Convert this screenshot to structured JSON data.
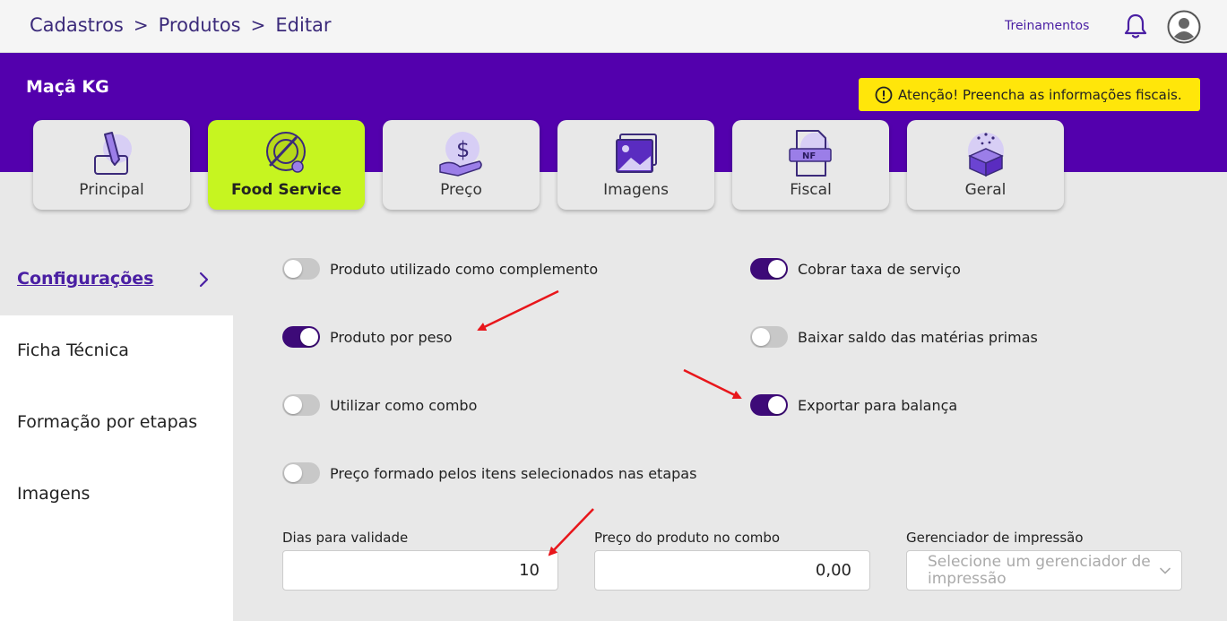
{
  "breadcrumb": {
    "items": [
      "Cadastros",
      "Produtos",
      "Editar"
    ],
    "separator": ">"
  },
  "header": {
    "training_link": "Treinamentos"
  },
  "product": {
    "name": "Maçã KG"
  },
  "alert": {
    "text": "Atenção! Preencha as informações fiscais.",
    "color": "#ffe60a"
  },
  "tabs": [
    {
      "label": "Principal",
      "icon": "edit-document-icon",
      "active": false
    },
    {
      "label": "Food Service",
      "icon": "food-plate-icon",
      "active": true
    },
    {
      "label": "Preço",
      "icon": "price-hand-icon",
      "active": false
    },
    {
      "label": "Imagens",
      "icon": "images-icon",
      "active": false
    },
    {
      "label": "Fiscal",
      "icon": "nf-document-icon",
      "active": false
    },
    {
      "label": "Geral",
      "icon": "gift-box-icon",
      "active": false
    }
  ],
  "sidebar": {
    "items": [
      {
        "label": "Configurações",
        "active": true
      },
      {
        "label": "Ficha Técnica",
        "active": false
      },
      {
        "label": "Formação por etapas",
        "active": false
      },
      {
        "label": "Imagens",
        "active": false
      }
    ]
  },
  "toggles": [
    {
      "label": "Produto utilizado como complemento",
      "on": false
    },
    {
      "label": "Cobrar taxa de serviço",
      "on": true
    },
    {
      "label": "Produto por peso",
      "on": true
    },
    {
      "label": "Baixar saldo das matérias primas",
      "on": false
    },
    {
      "label": "Utilizar como combo",
      "on": false
    },
    {
      "label": "Exportar para balança",
      "on": true
    },
    {
      "label": "Preço formado pelos itens selecionados nas etapas",
      "on": false
    }
  ],
  "fields": {
    "validity": {
      "label": "Dias para validade",
      "value": "10"
    },
    "combo_price": {
      "label": "Preço do produto no combo",
      "value": "0,00"
    },
    "print_manager": {
      "label": "Gerenciador de impressão",
      "placeholder": "Selecione um gerenciador de impressão"
    }
  },
  "colors": {
    "brand_purple": "#5300ad",
    "toggle_on": "#3d0a78",
    "active_tab": "#c6f520",
    "annotation_arrow": "#e8161b"
  }
}
